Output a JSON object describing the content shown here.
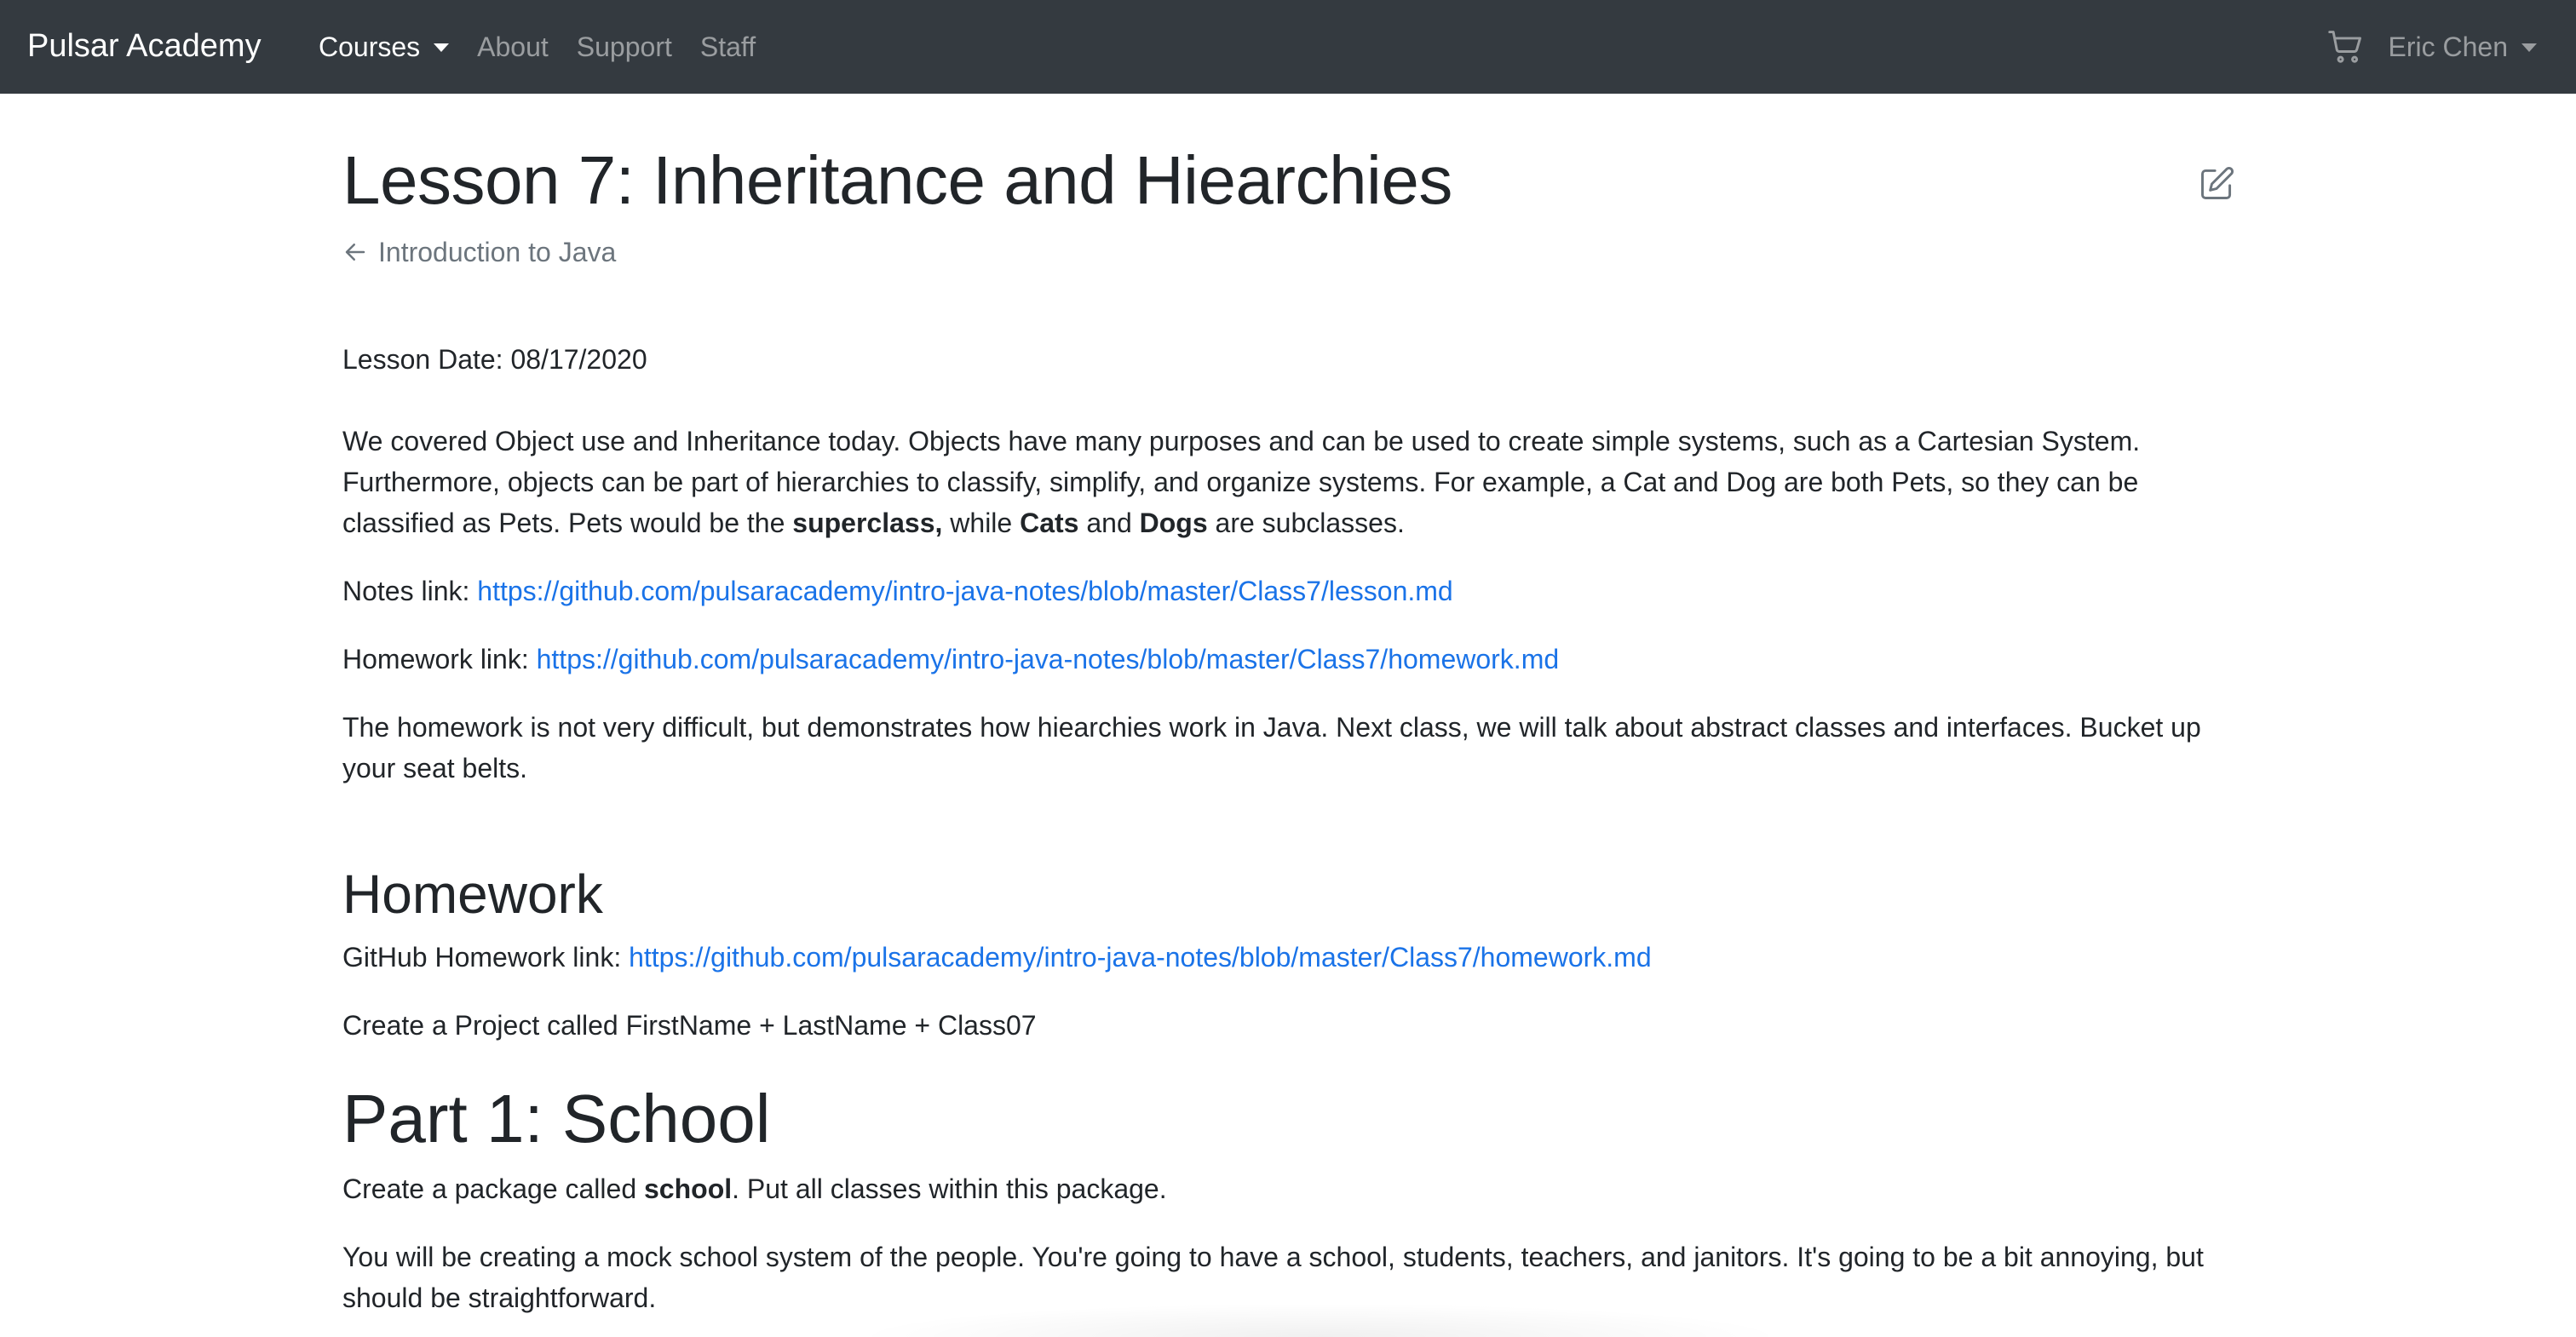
{
  "navbar": {
    "brand": "Pulsar Academy",
    "links": [
      {
        "label": "Courses",
        "active": true,
        "dropdown": true
      },
      {
        "label": "About",
        "active": false
      },
      {
        "label": "Support",
        "active": false
      },
      {
        "label": "Staff",
        "active": false
      }
    ],
    "cart_icon": "shopping-cart-icon",
    "user_name": "Eric Chen"
  },
  "lesson": {
    "title": "Lesson 7: Inheritance and Hiearchies",
    "edit_icon": "edit-pencil-icon",
    "back_label": "Introduction to Java",
    "date_line": "Lesson Date: 08/17/2020",
    "summary": {
      "part1": "We covered Object use and Inheritance today. Objects have many purposes and can be used to create simple systems, such as a Cartesian System. Furthermore, objects can be part of hierarchies to classify, simplify, and organize systems. For example, a Cat and Dog are both Pets, so they can be classified as Pets. Pets would be the ",
      "bold1": "superclass,",
      "part2": " while ",
      "bold2": "Cats",
      "part3": " and ",
      "bold3": "Dogs",
      "part4": " are subclasses."
    },
    "notes_label": "Notes link: ",
    "notes_url": "https://github.com/pulsaracademy/intro-java-notes/blob/master/Class7/lesson.md",
    "homework_label": "Homework link: ",
    "homework_url": "https://github.com/pulsaracademy/intro-java-notes/blob/master/Class7/homework.md",
    "closing": "The homework is not very difficult, but demonstrates how hiearchies work in Java. Next class, we will talk about abstract classes and interfaces. Bucket up your seat belts."
  },
  "homework": {
    "heading": "Homework",
    "github_label": "GitHub Homework link: ",
    "github_url": "https://github.com/pulsaracademy/intro-java-notes/blob/master/Class7/homework.md",
    "create_project": "Create a Project called FirstName + LastName + Class07"
  },
  "part1": {
    "heading": "Part 1: School",
    "package_pre": "Create a package called ",
    "package_bold": "school",
    "package_post": ". Put all classes within this package.",
    "description": "You will be creating a mock school system of the people. You're going to have a school, students, teachers, and janitors. It's going to be a bit annoying, but should be straightforward."
  }
}
